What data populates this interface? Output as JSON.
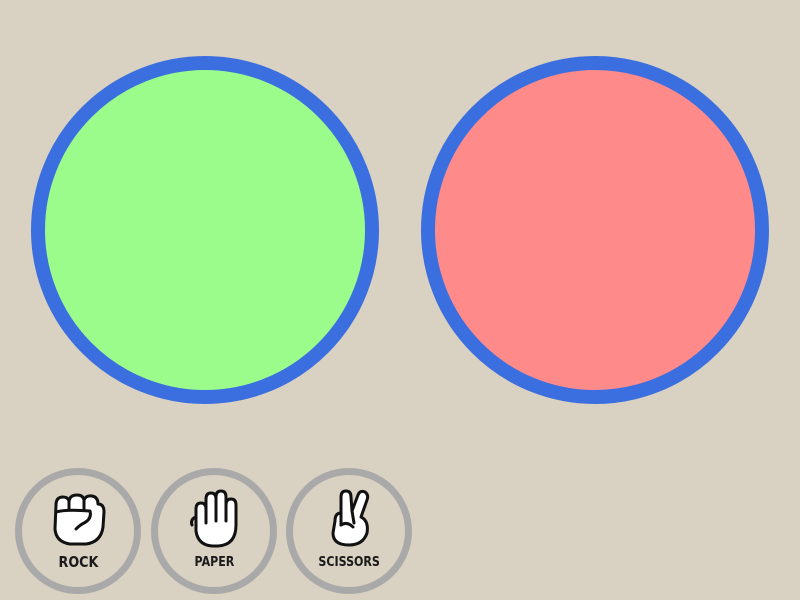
{
  "colors": {
    "background": "#d9d1c1",
    "circle_border": "#3b6fe0",
    "player_circle": "#9bfc8c",
    "opponent_circle": "#ff8a8a",
    "button_ring": "#a9a9a9"
  },
  "choices": [
    {
      "id": "rock",
      "label": "ROCK",
      "icon": "fist-icon"
    },
    {
      "id": "paper",
      "label": "PAPER",
      "icon": "open-hand-icon"
    },
    {
      "id": "scissors",
      "label": "SCISSORS",
      "icon": "peace-hand-icon"
    }
  ]
}
